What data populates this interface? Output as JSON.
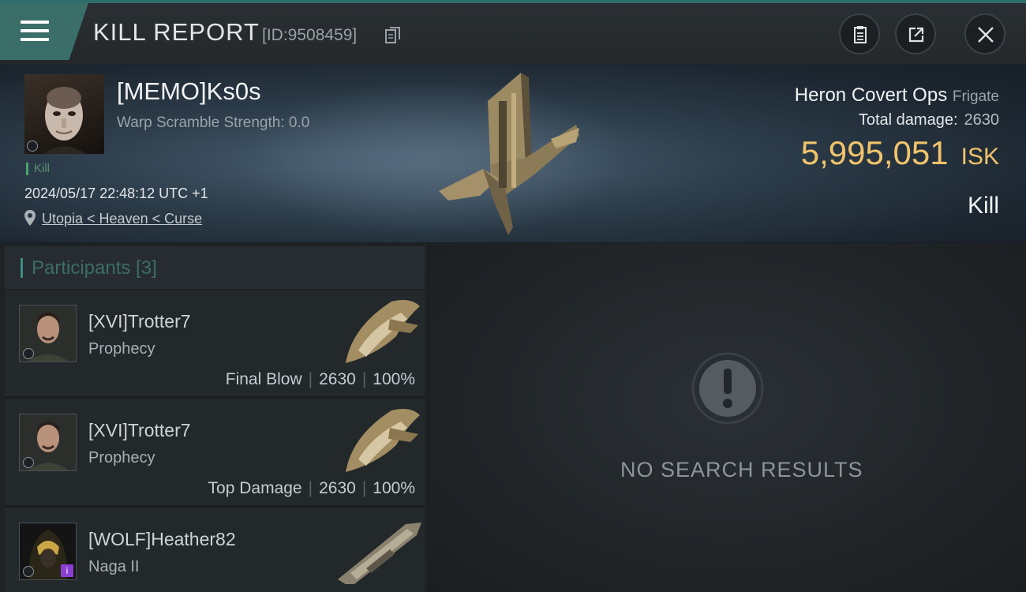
{
  "header": {
    "title": "KILL REPORT",
    "report_id": "[ID:9508459]"
  },
  "victim": {
    "name": "[MEMO]Ks0s",
    "warp_scramble": "Warp Scramble Strength: 0.0",
    "kill_tag": "Kill",
    "datetime": "2024/05/17 22:48:12 UTC +1",
    "location": "Utopia < Heaven < Curse"
  },
  "summary": {
    "ship_name": "Heron Covert Ops",
    "ship_class": "Frigate",
    "total_damage_label": "Total damage:",
    "total_damage": "2630",
    "isk_value": "5,995,051",
    "isk_unit": "ISK",
    "result": "Kill"
  },
  "participants": {
    "header": "Participants [3]",
    "items": [
      {
        "name": "[XVI]Trotter7",
        "ship": "Prophecy",
        "role": "Final Blow",
        "damage": "2630",
        "percent": "100%"
      },
      {
        "name": "[XVI]Trotter7",
        "ship": "Prophecy",
        "role": "Top Damage",
        "damage": "2630",
        "percent": "100%"
      },
      {
        "name": "[WOLF]Heather82",
        "ship": "Naga II",
        "role": "",
        "damage": "",
        "percent": ""
      }
    ]
  },
  "results": {
    "empty_text": "NO SEARCH RESULTS"
  },
  "colors": {
    "accent": "#3b6e69",
    "isk": "#f1c46b",
    "kill_green": "#4ca36e"
  },
  "icons": [
    "menu-icon",
    "copy-icon",
    "clipboard-icon",
    "share-icon",
    "close-icon",
    "location-pin-icon",
    "exclamation-icon"
  ]
}
